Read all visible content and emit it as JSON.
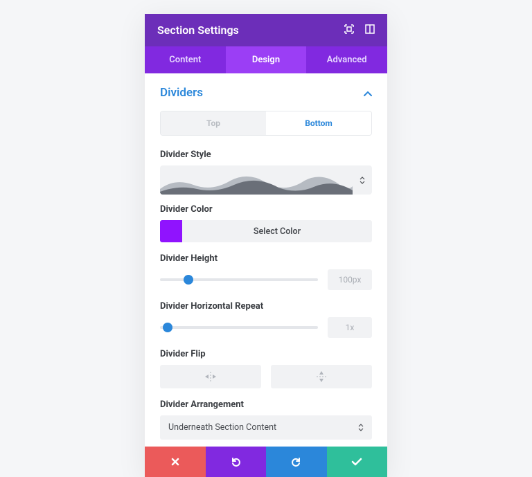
{
  "header": {
    "title": "Section Settings"
  },
  "tabs": {
    "content": "Content",
    "design": "Design",
    "advanced": "Advanced",
    "active": "design"
  },
  "section": {
    "title": "Dividers"
  },
  "position_toggle": {
    "top": "Top",
    "bottom": "Bottom",
    "active": "bottom"
  },
  "labels": {
    "divider_style": "Divider Style",
    "divider_color": "Divider Color",
    "divider_height": "Divider Height",
    "divider_horizontal_repeat": "Divider Horizontal Repeat",
    "divider_flip": "Divider Flip",
    "divider_arrangement": "Divider Arrangement"
  },
  "color": {
    "swatch": "#9013FE",
    "button_label": "Select Color"
  },
  "height": {
    "value": "100px",
    "slider_percent": 18
  },
  "repeat": {
    "value": "1x",
    "slider_percent": 5
  },
  "arrangement": {
    "selected": "Underneath Section Content"
  }
}
